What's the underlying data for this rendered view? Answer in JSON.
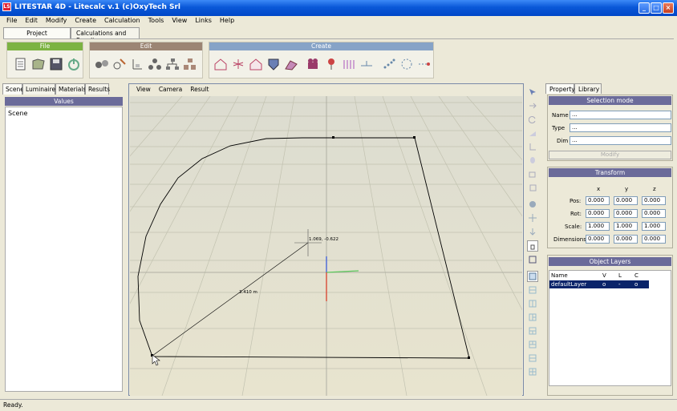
{
  "window": {
    "title": "LITESTAR 4D - Litecalc v.1       (c)OxyTech Srl",
    "app_icon": "LS",
    "minimize": "_",
    "maximize": "□",
    "close": "×"
  },
  "menu": [
    "File",
    "Edit",
    "Modify",
    "Create",
    "Calculation",
    "Tools",
    "View",
    "Links",
    "Help"
  ],
  "project_tabs": [
    "Project",
    "Calculations and Results"
  ],
  "groups": {
    "file": "File",
    "edit": "Edit",
    "create": "Create"
  },
  "colors": {
    "file": "#7cb342",
    "edit": "#9c8574",
    "create": "#86a3c7",
    "header": "#6b6b9a"
  },
  "left_tabs": [
    "Scene",
    "Luminaires",
    "Materials",
    "Results"
  ],
  "values_header": "Values",
  "scene_item": "Scene",
  "viewport_menu": [
    "View",
    "Camera",
    "Result"
  ],
  "viewport": {
    "coord_label": "1.069, -0.622",
    "measure_label": "3.410 m"
  },
  "right_tabs": [
    "Property",
    "Library"
  ],
  "selection": {
    "header": "Selection mode",
    "name_label": "Name",
    "name_value": "...",
    "type_label": "Type",
    "type_value": "...",
    "dim_label": "Dim",
    "dim_value": "...",
    "modify": "Modify"
  },
  "transform": {
    "header": "Transform",
    "cols": [
      "x",
      "y",
      "z"
    ],
    "rows": [
      {
        "label": "Pos:",
        "v": [
          "0.000",
          "0.000",
          "0.000"
        ]
      },
      {
        "label": "Rot:",
        "v": [
          "0.000",
          "0.000",
          "0.000"
        ]
      },
      {
        "label": "Scale:",
        "v": [
          "1.000",
          "1.000",
          "1.000"
        ]
      },
      {
        "label": "Dimensions",
        "v": [
          "0.000",
          "0.000",
          "0.000"
        ]
      }
    ]
  },
  "layers": {
    "header": "Object Layers",
    "cols": [
      "Name",
      "V",
      "L",
      "C"
    ],
    "row": [
      "defaultLayer",
      "o",
      "-",
      "o"
    ]
  },
  "status": "Ready."
}
